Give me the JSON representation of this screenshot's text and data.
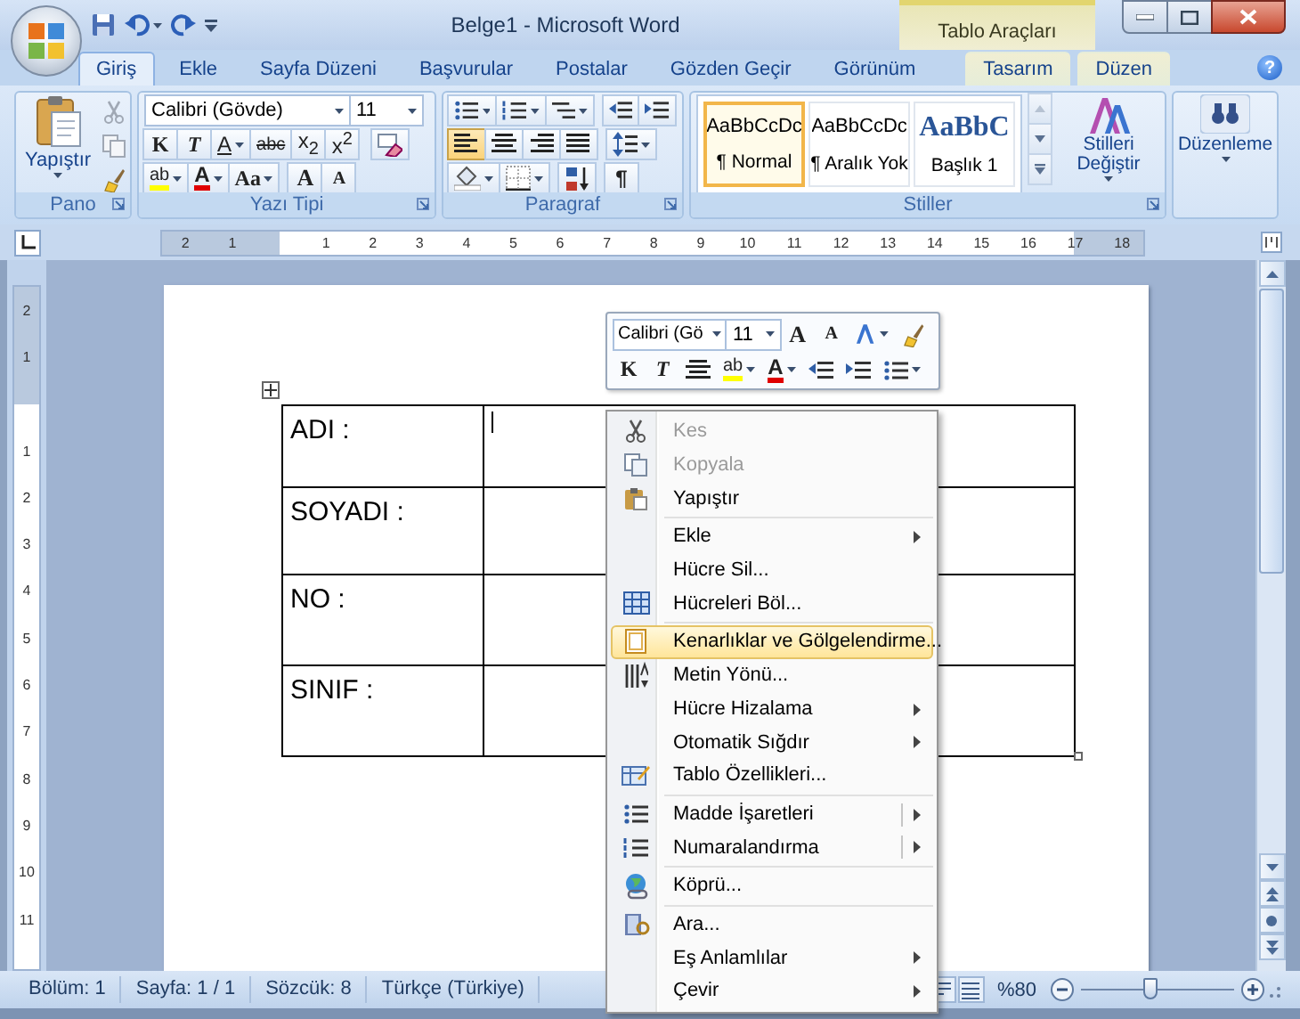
{
  "title_bar": {
    "title": "Belge1 - Microsoft Word",
    "contextual_tab": "Tablo Araçları"
  },
  "tabs": [
    {
      "label": "Giriş",
      "selected": true,
      "contextual": false
    },
    {
      "label": "Ekle",
      "selected": false,
      "contextual": false
    },
    {
      "label": "Sayfa Düzeni",
      "selected": false,
      "contextual": false
    },
    {
      "label": "Başvurular",
      "selected": false,
      "contextual": false
    },
    {
      "label": "Postalar",
      "selected": false,
      "contextual": false
    },
    {
      "label": "Gözden Geçir",
      "selected": false,
      "contextual": false
    },
    {
      "label": "Görünüm",
      "selected": false,
      "contextual": false
    },
    {
      "label": "Tasarım",
      "selected": false,
      "contextual": true
    },
    {
      "label": "Düzen",
      "selected": false,
      "contextual": true
    }
  ],
  "help_button": "?",
  "ribbon": {
    "clipboard": {
      "paste_label": "Yapıştır",
      "group_label": "Pano"
    },
    "font": {
      "font_name": "Calibri (Gövde)",
      "font_size": "11",
      "format_buttons": [
        {
          "kind": "bold",
          "label": "K"
        },
        {
          "kind": "italic",
          "label": "T"
        },
        {
          "kind": "underline",
          "label": "A"
        },
        {
          "kind": "strikethrough",
          "label": "abc"
        },
        {
          "kind": "subscript",
          "label": "x$_{2}$"
        },
        {
          "kind": "superscript",
          "label": "x$^{2}$"
        }
      ],
      "color_buttons": [
        {
          "kind": "highlight",
          "label": "ab"
        },
        {
          "kind": "font-color",
          "label": "A"
        },
        {
          "kind": "change-case",
          "label": "Aa"
        },
        {
          "kind": "grow",
          "label": "A"
        },
        {
          "kind": "shrink",
          "label": "A"
        }
      ],
      "group_label": "Yazı Tipi"
    },
    "paragraph": {
      "alignments": [
        {
          "kind": "left",
          "selected": true
        },
        {
          "kind": "center",
          "selected": false
        },
        {
          "kind": "right",
          "selected": false
        },
        {
          "kind": "justify",
          "selected": false
        }
      ],
      "show_marks_button": "¶",
      "group_label": "Paragraf"
    },
    "styles": {
      "items": [
        {
          "kind": "body",
          "sample": "AaBbCcDc",
          "name": "¶ Normal",
          "selected": true
        },
        {
          "kind": "body",
          "sample": "AaBbCcDc",
          "name": "¶ Aralık Yok",
          "selected": false
        },
        {
          "kind": "heading",
          "sample": "AaBbC",
          "name": "Başlık 1",
          "selected": false
        }
      ],
      "change_styles": "Stilleri Değiştir",
      "group_label": "Stiller"
    },
    "editing": {
      "label": "Düzenleme"
    }
  },
  "ruler": {
    "left_numbers": [
      "2",
      "1"
    ],
    "right_numbers": [
      "1",
      "2",
      "3",
      "4",
      "5",
      "6",
      "7",
      "8",
      "9",
      "10",
      "11",
      "12",
      "13",
      "14",
      "15",
      "16",
      "17",
      "18"
    ],
    "top_numbers": [
      "2",
      "1"
    ],
    "down_numbers": [
      "1",
      "2",
      "3",
      "4",
      "5",
      "6",
      "7",
      "8",
      "9",
      "10",
      "11"
    ]
  },
  "table": {
    "rows": [
      {
        "label": "ADI :",
        "has_caret": true
      },
      {
        "label": "SOYADI :",
        "has_caret": false
      },
      {
        "label": "NO :",
        "has_caret": false
      },
      {
        "label": "SINIF :",
        "has_caret": false
      }
    ]
  },
  "mini_toolbar": {
    "font_name": "Calibri (Gö",
    "font_size": "11",
    "grow": "A",
    "shrink": "A",
    "bold": "K",
    "italic": "T",
    "highlight": "ab",
    "font_color": "A"
  },
  "context_menu": {
    "groups": [
      {
        "items": [
          {
            "label": "Kes",
            "kind": "plain",
            "disabled": true,
            "selected": false
          },
          {
            "label": "Kopyala",
            "kind": "plain",
            "disabled": true,
            "selected": false
          },
          {
            "label": "Yapıştır",
            "kind": "plain",
            "disabled": false,
            "selected": false
          }
        ]
      },
      {
        "items": [
          {
            "label": "Ekle",
            "kind": "submenu",
            "disabled": false,
            "selected": false
          },
          {
            "label": "Hücre Sil...",
            "kind": "plain",
            "disabled": false,
            "selected": false
          },
          {
            "label": "Hücreleri Böl...",
            "kind": "plain",
            "disabled": false,
            "selected": false
          }
        ]
      },
      {
        "items": [
          {
            "label": "Kenarlıklar ve Gölgelendirme...",
            "kind": "plain",
            "disabled": false,
            "selected": true
          },
          {
            "label": "Metin Yönü...",
            "kind": "plain",
            "disabled": false,
            "selected": false
          },
          {
            "label": "Hücre Hizalama",
            "kind": "submenu",
            "disabled": false,
            "selected": false
          },
          {
            "label": "Otomatik Sığdır",
            "kind": "submenu",
            "disabled": false,
            "selected": false
          },
          {
            "label": "Tablo Özellikleri...",
            "kind": "plain",
            "disabled": false,
            "selected": false
          }
        ]
      },
      {
        "items": [
          {
            "label": "Madde İşaretleri",
            "kind": "split-submenu",
            "disabled": false,
            "selected": false
          },
          {
            "label": "Numaralandırma",
            "kind": "split-submenu",
            "disabled": false,
            "selected": false
          }
        ]
      },
      {
        "items": [
          {
            "label": "Köprü...",
            "kind": "plain",
            "disabled": false,
            "selected": false
          }
        ]
      },
      {
        "items": [
          {
            "label": "Ara...",
            "kind": "plain",
            "disabled": false,
            "selected": false
          },
          {
            "label": "Eş Anlamlılar",
            "kind": "submenu",
            "disabled": false,
            "selected": false
          },
          {
            "label": "Çevir",
            "kind": "submenu",
            "disabled": false,
            "selected": false
          }
        ]
      }
    ]
  },
  "status_bar": {
    "items": [
      "Bölüm: 1",
      "Sayfa: 1 / 1",
      "Sözcük: 8",
      "Türkçe (Türkiye)"
    ],
    "zoom": "%80",
    "zoom_slider": {
      "level": 0.45
    }
  }
}
